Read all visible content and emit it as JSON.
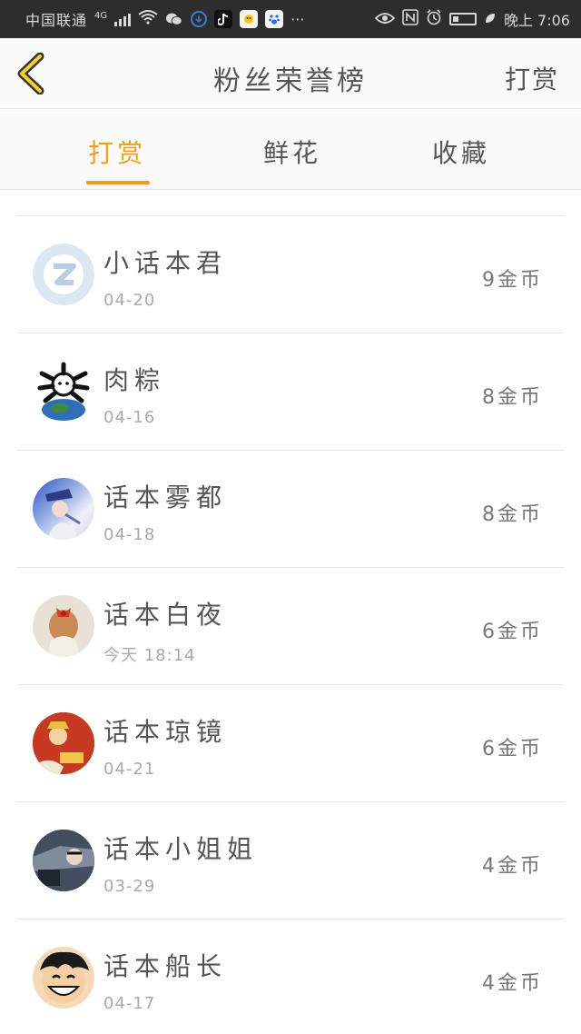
{
  "status_bar": {
    "carrier": "中国联通",
    "network": "4G",
    "time": "晚上 7:06"
  },
  "header": {
    "title": "粉丝荣誉榜",
    "action": "打赏"
  },
  "tabs": [
    {
      "label": "打赏",
      "active": true
    },
    {
      "label": "鲜花",
      "active": false
    },
    {
      "label": "收藏",
      "active": false
    }
  ],
  "list": [
    {
      "name": "小话本君",
      "date": "04-20",
      "amount": "9金币",
      "avatar": "qq-logo-avatar"
    },
    {
      "name": "肉粽",
      "date": "04-16",
      "amount": "8金币",
      "avatar": "cartoon-globe-avatar"
    },
    {
      "name": "话本雾都",
      "date": "04-18",
      "amount": "8金币",
      "avatar": "anime-kid-avatar"
    },
    {
      "name": "话本白夜",
      "date": "今天 18:14",
      "amount": "6金币",
      "avatar": "girl-bow-avatar"
    },
    {
      "name": "话本琼镜",
      "date": "04-21",
      "amount": "6金币",
      "avatar": "anime-collage-avatar"
    },
    {
      "name": "话本小姐姐",
      "date": "03-29",
      "amount": "4金币",
      "avatar": "car-photo-avatar"
    },
    {
      "name": "话本船长",
      "date": "04-17",
      "amount": "4金币",
      "avatar": "luffy-avatar"
    }
  ],
  "colors": {
    "accent": "#e8a020",
    "status_bar_bg": "#2d2d2d",
    "text": "#555555",
    "muted": "#aaaaaa"
  }
}
